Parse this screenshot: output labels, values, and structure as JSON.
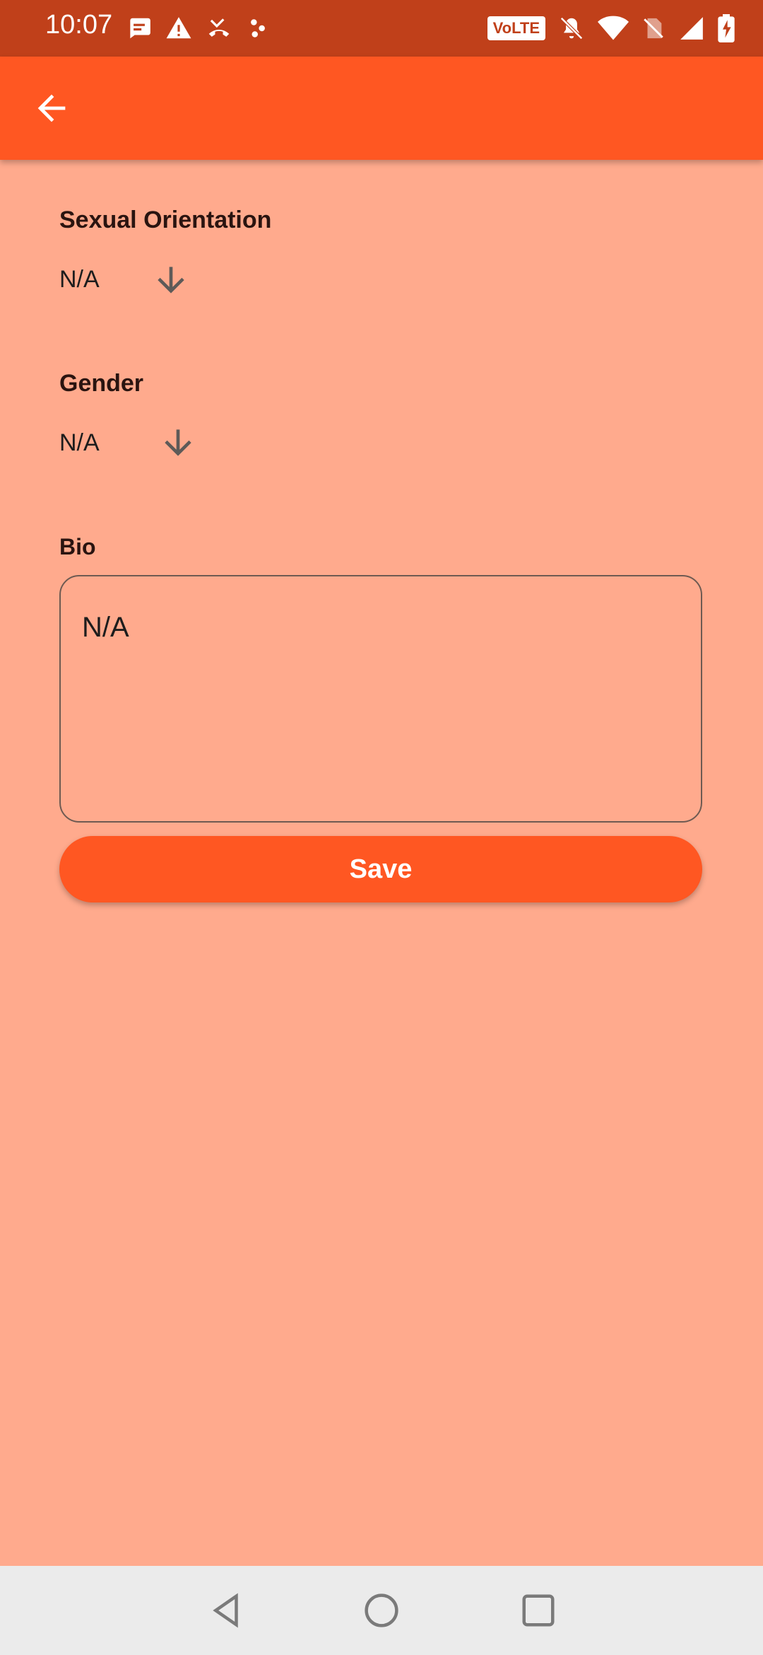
{
  "status_bar": {
    "time": "10:07",
    "network_badge": "VoLTE",
    "left_icons": [
      "message-icon",
      "warning-icon",
      "missed-call-icon",
      "app-notification-icon"
    ],
    "right_icons": [
      "volte-icon",
      "mute-icon",
      "wifi-icon",
      "no-sim-icon",
      "signal-icon",
      "battery-charging-icon"
    ]
  },
  "app_bar": {
    "back_icon": "arrow-left-icon"
  },
  "form": {
    "sexual_orientation": {
      "label": "Sexual Orientation",
      "value": "N/A"
    },
    "gender": {
      "label": "Gender",
      "value": "N/A"
    },
    "bio": {
      "label": "Bio",
      "value": "N/A"
    },
    "save_label": "Save"
  },
  "colors": {
    "status_bar": "#C0401A",
    "app_bar": "#FF5722",
    "background": "#FFAA8D",
    "button": "#FF5722",
    "nav_bar": "#EBEBEB"
  },
  "nav_bar": {
    "buttons": [
      "back-triangle-icon",
      "home-circle-icon",
      "recents-square-icon"
    ]
  }
}
